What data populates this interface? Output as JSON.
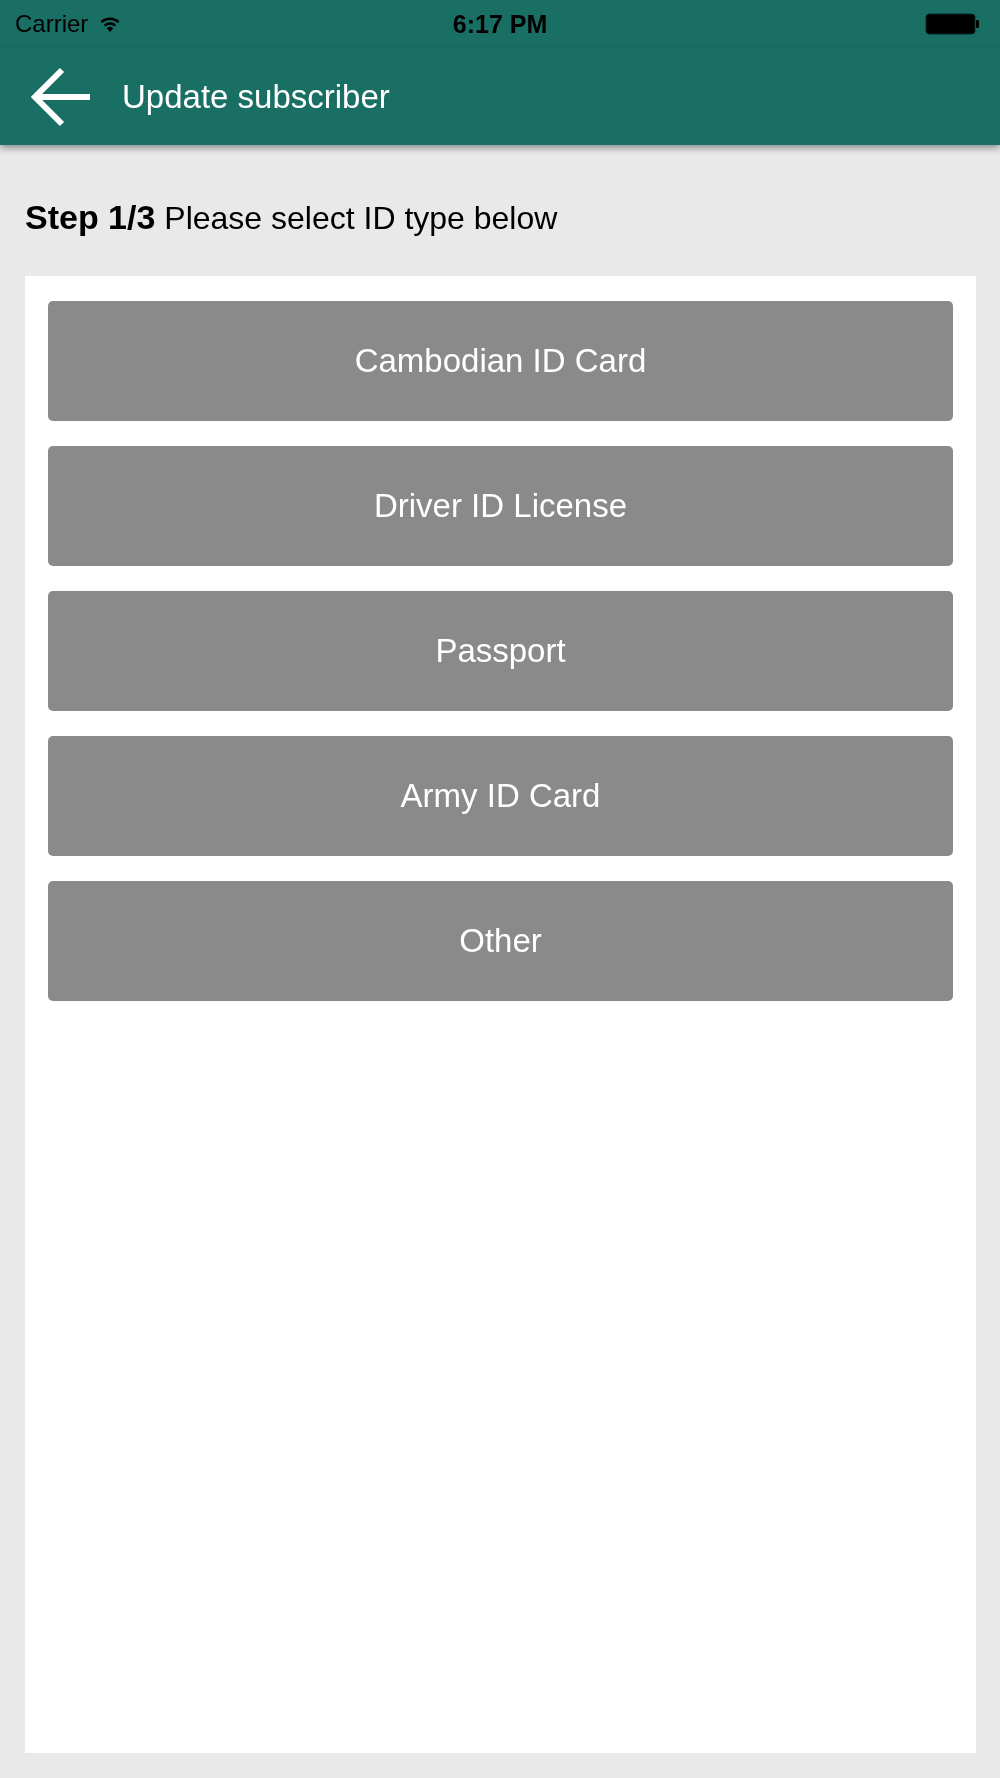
{
  "status_bar": {
    "carrier": "Carrier",
    "time": "6:17 PM"
  },
  "app_bar": {
    "title": "Update subscriber"
  },
  "step_text": "**Step 1/3** Please select ID type below",
  "id_types": [
    {
      "label": "Cambodian ID Card"
    },
    {
      "label": "Driver ID License"
    },
    {
      "label": "Passport"
    },
    {
      "label": "Army ID Card"
    },
    {
      "label": "Other"
    }
  ]
}
